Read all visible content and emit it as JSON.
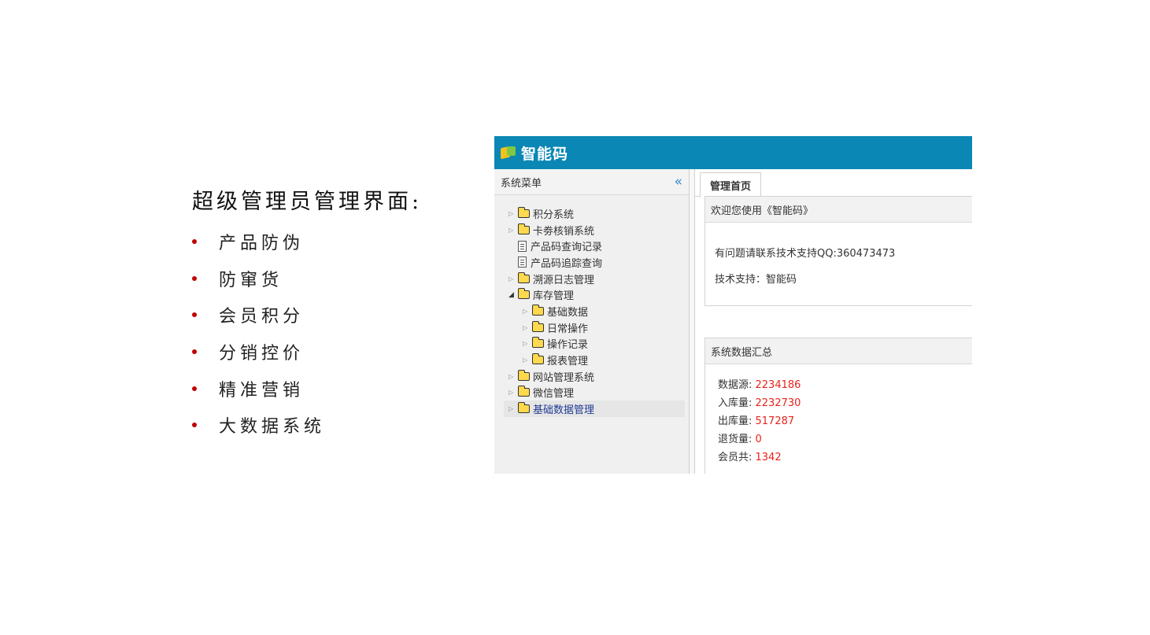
{
  "slide": {
    "title": "超级管理员管理界面:",
    "bullets": [
      "产品防伪",
      "防窜货",
      "会员积分",
      "分销控价",
      "精准营销",
      "大数据系统"
    ]
  },
  "app": {
    "title": "智能码",
    "header_color": "#0a87b4",
    "sidebar": {
      "title": "系统菜单",
      "collapse_icon": "«",
      "tree": [
        {
          "label": "积分系统"
        },
        {
          "label": "卡劵核销系统"
        },
        {
          "label": "产品码查询记录"
        },
        {
          "label": "产品码追踪查询"
        },
        {
          "label": "溯源日志管理"
        },
        {
          "label": "库存管理"
        },
        {
          "label": "基础数据"
        },
        {
          "label": "日常操作"
        },
        {
          "label": "操作记录"
        },
        {
          "label": "报表管理"
        },
        {
          "label": "网站管理系统"
        },
        {
          "label": "微信管理"
        },
        {
          "label": "基础数据管理"
        }
      ]
    },
    "tab": "管理首页",
    "welcome": {
      "heading": "欢迎您使用《智能码》",
      "line1": "有问题请联系技术支持QQ:360473473",
      "line2": "技术支持：智能码"
    },
    "stats": {
      "heading": "系统数据汇总",
      "rows": [
        {
          "label": "数据源: ",
          "value": "2234186"
        },
        {
          "label": "入库量: ",
          "value": "2232730"
        },
        {
          "label": "出库量: ",
          "value": "517287"
        },
        {
          "label": "退货量: ",
          "value": "0"
        },
        {
          "label": "会员共: ",
          "value": "1342"
        }
      ],
      "value_color": "#e8221b"
    }
  }
}
